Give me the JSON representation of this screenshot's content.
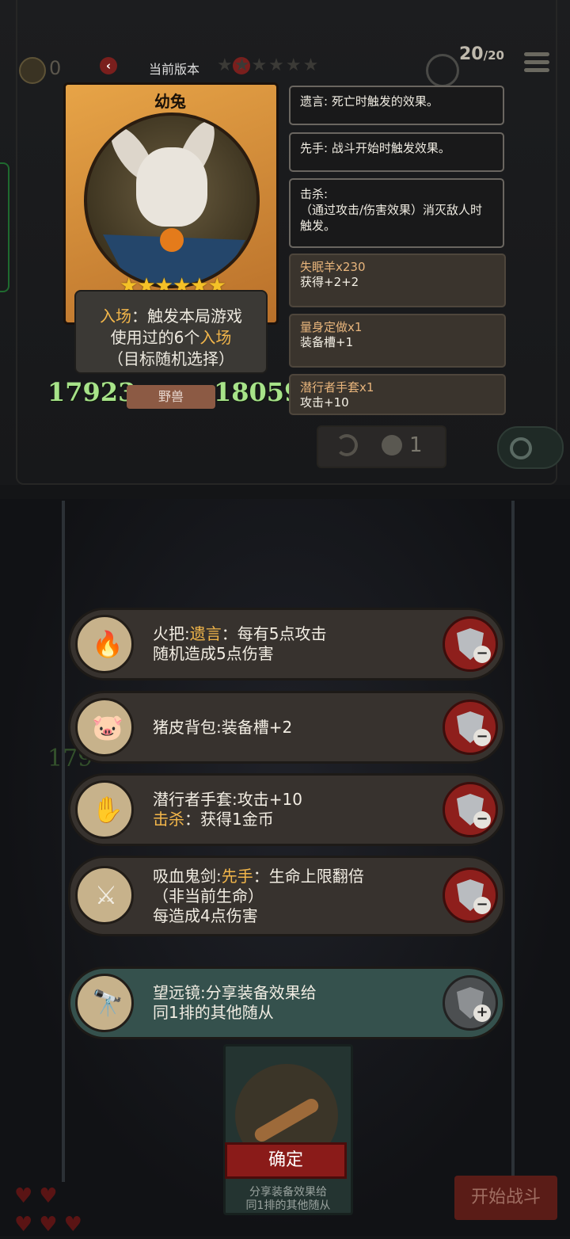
{
  "top": {
    "coin_count": "0",
    "version_label": "当前版本",
    "version_stars": "★★★★★★",
    "battle_count": "20",
    "battle_total": "/20"
  },
  "card": {
    "name": "幼兔",
    "stars": "★★★★★★",
    "stars_rating": 6,
    "desc_line1_hl": "入场",
    "desc_line1_rest": "：触发本局游戏",
    "desc_line2_a": "使用过的6个",
    "desc_line2_hl": "入场",
    "desc_line3": "（目标随机选择）",
    "attack": "17923",
    "health": "18059",
    "tribe": "野兽"
  },
  "tooltips": [
    {
      "text": "遗言: 死亡时触发的效果。"
    },
    {
      "text": "先手: 战斗开始时触发效果。"
    },
    {
      "text": "击杀:"
    },
    {
      "text": "（通过攻击/伤害效果）消灭敌人时触发。"
    }
  ],
  "buffs": [
    {
      "name": "失眠羊x230",
      "effect": "获得+2+2"
    },
    {
      "name": "量身定做x1",
      "effect": "装备槽+1"
    },
    {
      "name": "潜行者手套x1",
      "effect": "攻击+10"
    }
  ],
  "refresh_cost": "1",
  "equipment": [
    {
      "name": "火把:",
      "hl": "遗言",
      "rest": "：每有5点攻击",
      "line2": "随机造成5点伤害",
      "line3": "",
      "icon": "torch-icon",
      "glyph": "🔥"
    },
    {
      "name": "猪皮背包:装备槽+2",
      "hl": "",
      "rest": "",
      "line2": "",
      "line3": "",
      "icon": "pig-backpack-icon",
      "glyph": "🐷"
    },
    {
      "name": "潜行者手套:攻击+10",
      "hl": "",
      "rest": "",
      "line2_hl": "击杀",
      "line2": "：获得1金币",
      "line3": "",
      "icon": "glove-icon",
      "glyph": "✋"
    },
    {
      "name": "吸血鬼剑:",
      "hl": "先手",
      "rest": "：生命上限翻倍",
      "line2": "（非当前生命）",
      "line3": "每造成4点伤害",
      "icon": "vampire-sword-icon",
      "glyph": "⚔"
    },
    {
      "name": "望远镜:分享装备效果给",
      "line2": "同1排的其他随从",
      "icon": "telescope-icon",
      "glyph": "🔭"
    }
  ],
  "preview": {
    "line1": "分享装备效果给",
    "line2": "同1排的其他随从"
  },
  "buttons": {
    "confirm": "确定",
    "start_battle": "开始战斗"
  },
  "colors": {
    "highlight": "#f2b64a",
    "stat_green": "#a7e389",
    "danger_red": "#8e1f1c"
  }
}
